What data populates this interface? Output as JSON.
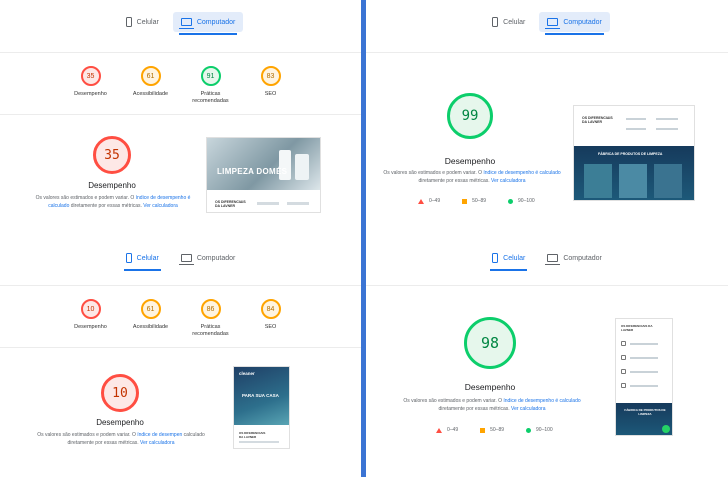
{
  "tabs": {
    "mobile": "Celular",
    "desktop": "Computador"
  },
  "panels": {
    "top_left": {
      "selected_tab": "Computador",
      "gauges": [
        {
          "label": "Desempenho",
          "score": "35",
          "rating": "red"
        },
        {
          "label": "Acessibilidade",
          "score": "61",
          "rating": "orange"
        },
        {
          "label": "Práticas recomendadas",
          "score": "91",
          "rating": "green"
        },
        {
          "label": "SEO",
          "score": "83",
          "rating": "orange"
        }
      ],
      "main_score": "35",
      "main_label": "Desempenho",
      "note": {
        "a": "Os valores são estimados e podem variar. O ",
        "link1": "índice de desempenho é calculado",
        "b": " diretamente por essas métricas. ",
        "link2": "Ver calculadora"
      },
      "screenshot_text": {
        "hero": "LIMPEZA DOMÉS",
        "foot": "OS DIFERENCIAIS DA LAVNER"
      }
    },
    "bottom_left": {
      "selected_tab": "Celular",
      "gauges": [
        {
          "label": "Desempenho",
          "score": "10",
          "rating": "red"
        },
        {
          "label": "Acessibilidade",
          "score": "61",
          "rating": "orange"
        },
        {
          "label": "Práticas recomendadas",
          "score": "86",
          "rating": "orange"
        },
        {
          "label": "SEO",
          "score": "84",
          "rating": "orange"
        }
      ],
      "main_score": "10",
      "main_label": "Desempenho",
      "note": {
        "a": "Os valores são estimados e podem variar. O ",
        "link1": "índice de desempen",
        "b": " calculado diretamente por essas métricas. ",
        "link2": "Ver calculadora"
      },
      "screenshot_text": {
        "brand": "cleaner",
        "hero": "PARA SUA CASA",
        "foot": "OS DIFERENCIAIS DA LAVNER"
      }
    },
    "top_right": {
      "selected_tab": "Computador",
      "main_score": "99",
      "main_label": "Desempenho",
      "note": {
        "a": "Os valores são estimados e podem variar. O ",
        "link1": "índice de desempenho é calculado",
        "b": " diretamente por essas métricas. ",
        "link2": "Ver calculadora"
      },
      "legend": [
        "0–49",
        "50–89",
        "90–100"
      ],
      "screenshot_text": {
        "head": "OS DIFERENCIAIS DA LAVNER",
        "band": "FÁBRICA DE PRODUTOS DE LIMPEZA"
      }
    },
    "bottom_right": {
      "selected_tab": "Celular",
      "main_score": "98",
      "main_label": "Desempenho",
      "note": {
        "a": "Os valores são estimados e podem variar. O ",
        "link1": "índice de desempenho é calculado",
        "b": " diretamente por essas métricas. ",
        "link2": "Ver calculadora"
      },
      "legend": [
        "0–49",
        "50–89",
        "90–100"
      ],
      "screenshot_text": {
        "head": "OS DIFERENCIAIS DA LAVNER",
        "band": "FÁBRICA DE PRODUTOS DE LIMPEZA"
      }
    }
  },
  "colors": {
    "fail": "#ff4e42",
    "average": "#ffa400",
    "pass": "#0cce6b",
    "link": "#1a73e8",
    "divider": "#3b74d4"
  }
}
